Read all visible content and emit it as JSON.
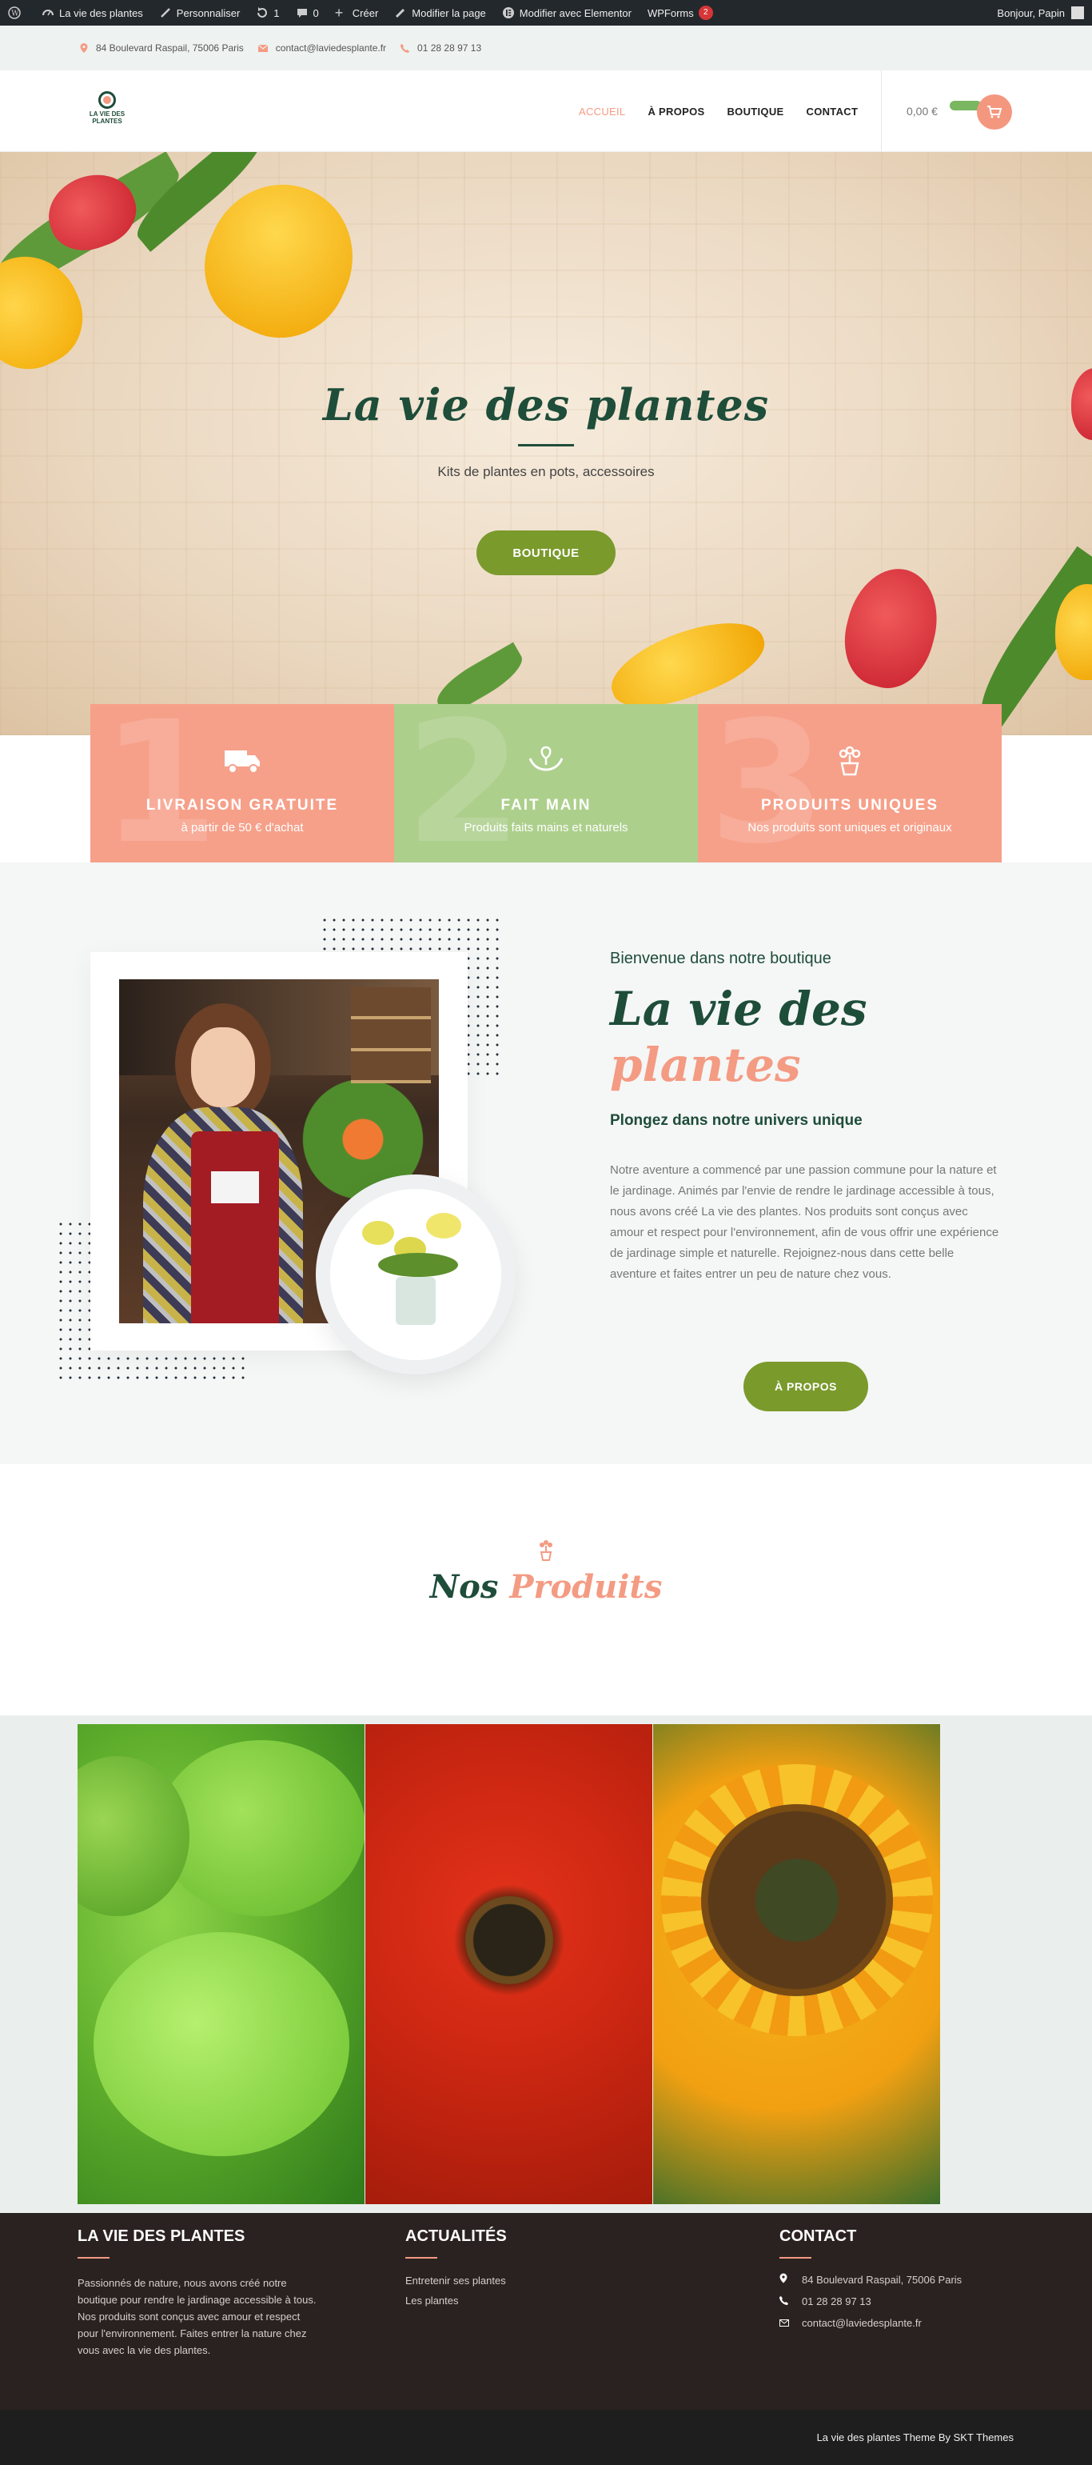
{
  "adminbar": {
    "site": "La vie des plantes",
    "customize": "Personnaliser",
    "updates": "1",
    "comments": "0",
    "new": "Créer",
    "edit_page": "Modifier la page",
    "elementor": "Modifier avec Elementor",
    "wpforms": "WPForms",
    "wpforms_count": "2",
    "greeting": "Bonjour, Papin"
  },
  "infobar": {
    "address": "84 Boulevard Raspail, 75006 Paris",
    "email": "contact@laviedesplante.fr",
    "phone": "01 28 28 97 13"
  },
  "header": {
    "logo_line1": "LA VIE DES",
    "logo_line2": "PLANTES",
    "nav": [
      "ACCUEIL",
      "À PROPOS",
      "BOUTIQUE",
      "CONTACT"
    ],
    "cart_total": "0,00 €"
  },
  "hero": {
    "title": "La vie des plantes",
    "subtitle": "Kits de plantes en pots, accessoires",
    "button": "BOUTIQUE"
  },
  "features": [
    {
      "num": "1",
      "title": "LIVRAISON GRATUITE",
      "sub": "à partir de 50 € d'achat",
      "icon": "truck-icon"
    },
    {
      "num": "2",
      "title": "FAIT MAIN",
      "sub": "Produits faits mains et naturels",
      "icon": "hands-plant-icon"
    },
    {
      "num": "3",
      "title": "PRODUITS UNIQUES",
      "sub": "Nos produits sont uniques et originaux",
      "icon": "flower-pot-icon"
    }
  ],
  "about": {
    "kicker": "Bienvenue dans notre boutique",
    "title_line1": "La vie des",
    "title_line2": "plantes",
    "subtitle": "Plongez dans notre univers unique",
    "text": "Notre aventure a commencé par une passion commune pour la nature et le jardinage. Animés par l'envie de rendre le jardinage accessible à tous, nous avons créé La vie des plantes. Nos produits sont conçus avec amour et respect pour l'environnement, afin de vous offrir une expérience de jardinage simple et naturelle. Rejoignez-nous dans cette belle aventure et faites entrer un peu de nature chez vous.",
    "button": "À PROPOS"
  },
  "products": {
    "title_part1": "Nos",
    "title_part2": "Produits"
  },
  "footer": {
    "col1_title": "LA VIE DES PLANTES",
    "col1_text": "Passionnés de nature, nous avons créé notre boutique pour rendre le jardinage accessible à tous. Nos produits sont conçus avec amour et respect pour l'environnement. Faites entrer la nature chez vous avec la vie des plantes.",
    "col2_title": "ACTUALITÉS",
    "col2_links": [
      "Entretenir ses plantes",
      "Les plantes"
    ],
    "col3_title": "CONTACT",
    "col3_address": "84 Boulevard Raspail, 75006 Paris",
    "col3_phone": "01 28 28 97 13",
    "col3_email": "contact@laviedesplante.fr",
    "copyright": "La vie des plantes Theme By SKT Themes"
  },
  "colors": {
    "brand_green": "#1e4d3a",
    "accent_pink": "#f49b83",
    "button_green": "#7a9a2c",
    "feature_green": "#adcf8c"
  }
}
